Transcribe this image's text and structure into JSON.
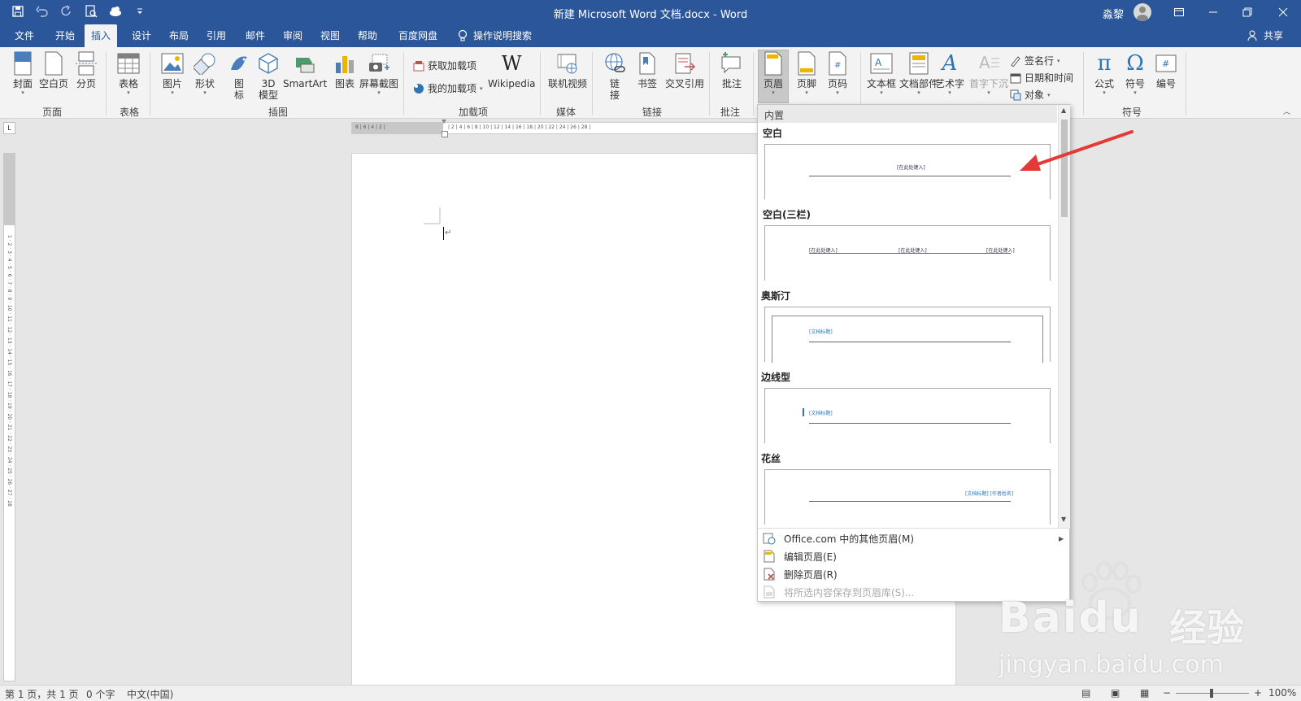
{
  "window": {
    "title": "新建 Microsoft Word 文档.docx  -  Word",
    "user": "淼黎"
  },
  "tabs": [
    {
      "label": "文件"
    },
    {
      "label": "开始"
    },
    {
      "label": "插入"
    },
    {
      "label": "设计"
    },
    {
      "label": "布局"
    },
    {
      "label": "引用"
    },
    {
      "label": "邮件"
    },
    {
      "label": "审阅"
    },
    {
      "label": "视图"
    },
    {
      "label": "帮助"
    },
    {
      "label": "百度网盘"
    }
  ],
  "tell_me": "操作说明搜索",
  "share": "共享",
  "ribbon": {
    "groups": {
      "pages": "页面",
      "tables": "表格",
      "illustrations": "插图",
      "addins": "加载项",
      "media": "媒体",
      "links": "链接",
      "comments": "批注",
      "symbols": "符号"
    },
    "buttons": {
      "cover": "封面",
      "blank_page": "空白页",
      "page_break": "分页",
      "table": "表格",
      "pictures": "图片",
      "shapes": "形状",
      "icons_line1": "图",
      "icons_line2": "标",
      "model_line1": "3D",
      "model_line2": "模型",
      "smartart": "SmartArt",
      "chart": "图表",
      "screenshot": "屏幕截图",
      "get_addins": "获取加载项",
      "my_addins": "我的加载项",
      "wikipedia": "Wikipedia",
      "online_video": "联机视频",
      "link_line1": "链",
      "link_line2": "接",
      "bookmark": "书签",
      "cross_ref": "交叉引用",
      "comment": "批注",
      "header": "页眉",
      "footer": "页脚",
      "page_number": "页码",
      "text_box": "文本框",
      "quick_parts": "文档部件",
      "wordart": "艺术字",
      "drop_cap": "首字下沉",
      "signature_line": "签名行",
      "date_time": "日期和时间",
      "object": "对象",
      "equation": "公式",
      "symbol": "符号",
      "number": "编号"
    }
  },
  "header_gallery": {
    "section": "内置",
    "items": [
      {
        "name": "空白",
        "placeholders": [
          "[在此处键入]"
        ]
      },
      {
        "name": "空白(三栏)",
        "placeholders": [
          "[在此处键入]",
          "[在此处键入]",
          "[在此处键入]"
        ]
      },
      {
        "name": "奥斯汀",
        "placeholders": [
          "[文档标题]"
        ]
      },
      {
        "name": "边线型",
        "placeholders": [
          "[文档标题]"
        ]
      },
      {
        "name": "花丝",
        "placeholders": [
          "[文档标题] [作者姓名]"
        ]
      }
    ],
    "menu": [
      {
        "label": "Office.com 中的其他页眉(M)",
        "disabled": false
      },
      {
        "label": "编辑页眉(E)",
        "disabled": false
      },
      {
        "label": "删除页眉(R)",
        "disabled": false
      },
      {
        "label": "将所选内容保存到页眉库(S)...",
        "disabled": true
      }
    ]
  },
  "status_bar": {
    "page": "第 1 页，共 1 页",
    "words": "0 个字",
    "language": "中文(中国)",
    "zoom": "100%"
  },
  "watermark": {
    "brand": "Baidu",
    "cn": "经验",
    "url": "jingyan.baidu.com"
  },
  "colors": {
    "accent": "#2b579a",
    "arrow": "#e53935"
  }
}
